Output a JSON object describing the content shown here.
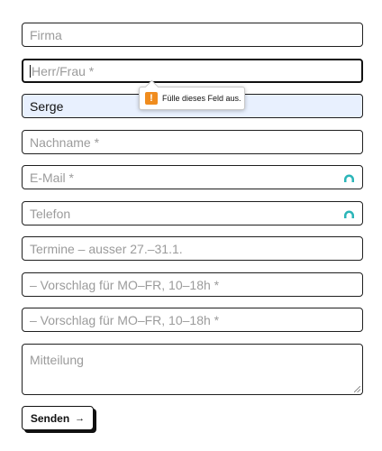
{
  "form": {
    "company": {
      "placeholder": "Firma"
    },
    "salutation": {
      "placeholder": "Herr/Frau *"
    },
    "first_name": {
      "value": "Serge"
    },
    "last_name": {
      "placeholder": "Nachname *"
    },
    "email": {
      "placeholder": "E-Mail *"
    },
    "phone": {
      "placeholder": "Telefon"
    },
    "dates": {
      "placeholder": "Termine – ausser 27.–31.1."
    },
    "proposal_1": {
      "placeholder": "– Vorschlag für MO–FR, 10–18h *"
    },
    "proposal_2": {
      "placeholder": "– Vorschlag für MO–FR, 10–18h *"
    },
    "message": {
      "placeholder": "Mitteilung"
    },
    "submit": {
      "label": "Senden",
      "arrow": "→"
    }
  },
  "validation_tooltip": {
    "icon": "!",
    "text": "Fülle dieses Feld aus."
  },
  "colors": {
    "autofill_icon": "#2bb5b8",
    "autofill_background": "#e8f0fe",
    "warning": "#f08c1e"
  }
}
